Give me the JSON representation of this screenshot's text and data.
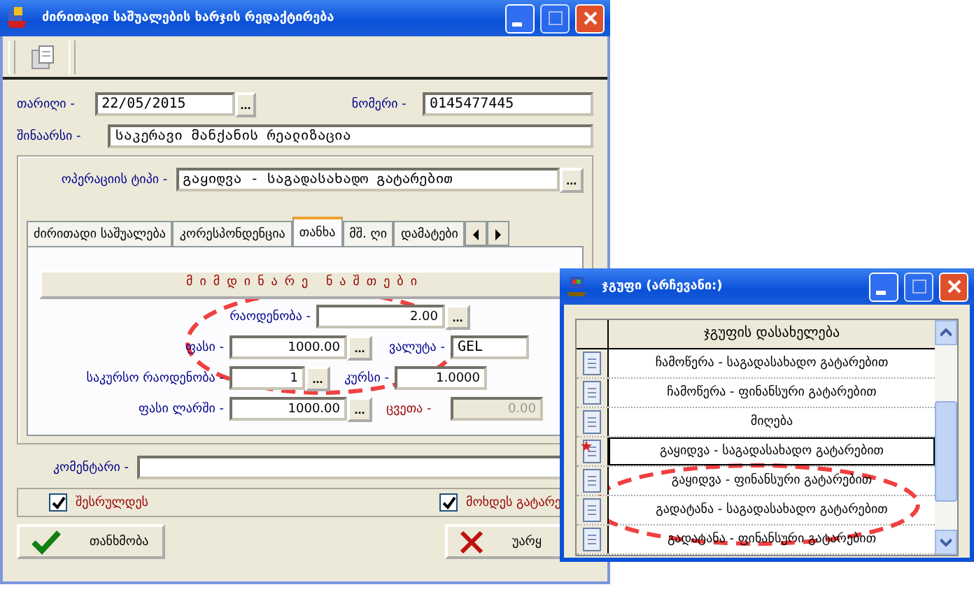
{
  "window": {
    "title": "ძირითადი საშუალების ხარჯის რედაქტირება"
  },
  "fields": {
    "date_label": "თარიღი -",
    "date": "22/05/2015",
    "number_label": "ნომერი -",
    "number": "0145477445",
    "content_label": "შინაარსი -",
    "content": "საკერავი მანქანის რეალიზაცია",
    "operation_label": "ოპერაციის ტიპი -",
    "operation": "გაყიდვა - საგადასახადო გატარებით",
    "browse": "..."
  },
  "tabs": [
    {
      "label": "ძირითადი საშუალება",
      "selected": false
    },
    {
      "label": "კორესპონდენცია",
      "selected": false
    },
    {
      "label": "თანხა",
      "selected": true
    },
    {
      "label": "მშ. ღი",
      "selected": false
    },
    {
      "label": "დამატები",
      "selected": false
    }
  ],
  "section_title": "მიმდინარე ნაშთები",
  "amount": {
    "quantity_label": "რაოდენობა -",
    "quantity": "2.00",
    "price_label": "ფასი -",
    "price": "1000.00",
    "currency_label": "ვალუტა -",
    "currency": "GEL",
    "rate_qty_label": "საკურსო რაოდენობა -",
    "rate_qty": "1",
    "rate_label": "კურსი -",
    "rate": "1.0000",
    "price_gel_label": "ფასი ლარში -",
    "price_gel": "1000.00",
    "wear_label": "ცვეთა -",
    "wear": "0.00"
  },
  "comment_label": "კომენტარი -",
  "checks": [
    {
      "label": "შესრულდეს",
      "checked": true
    },
    {
      "label": "მოხდეს გატარე",
      "checked": true
    }
  ],
  "buttons": [
    {
      "kind": "ok",
      "label": "თანხმობა"
    },
    {
      "kind": "cancel",
      "label": "უარყ"
    }
  ],
  "dialog": {
    "title": "ჯგუფი (არჩევანი:)",
    "column": "ჯგუფის დასახელება",
    "rows": [
      {
        "name": "ჩამოწერა - საგადასახადო გატარებით",
        "selected": false
      },
      {
        "name": "ჩამოწერა - ფინანსური გატარებით",
        "selected": false
      },
      {
        "name": "მიღება",
        "selected": false
      },
      {
        "name": "გაყიდვა - საგადასახადო გატარებით",
        "selected": true
      },
      {
        "name": "გაყიდვა - ფინანსური გატარებით",
        "selected": false
      },
      {
        "name": "გადატანა - საგადასახადო გატარებით",
        "selected": false
      },
      {
        "name": "გადატანა - ფინანსური გატარებით",
        "selected": false
      }
    ]
  }
}
